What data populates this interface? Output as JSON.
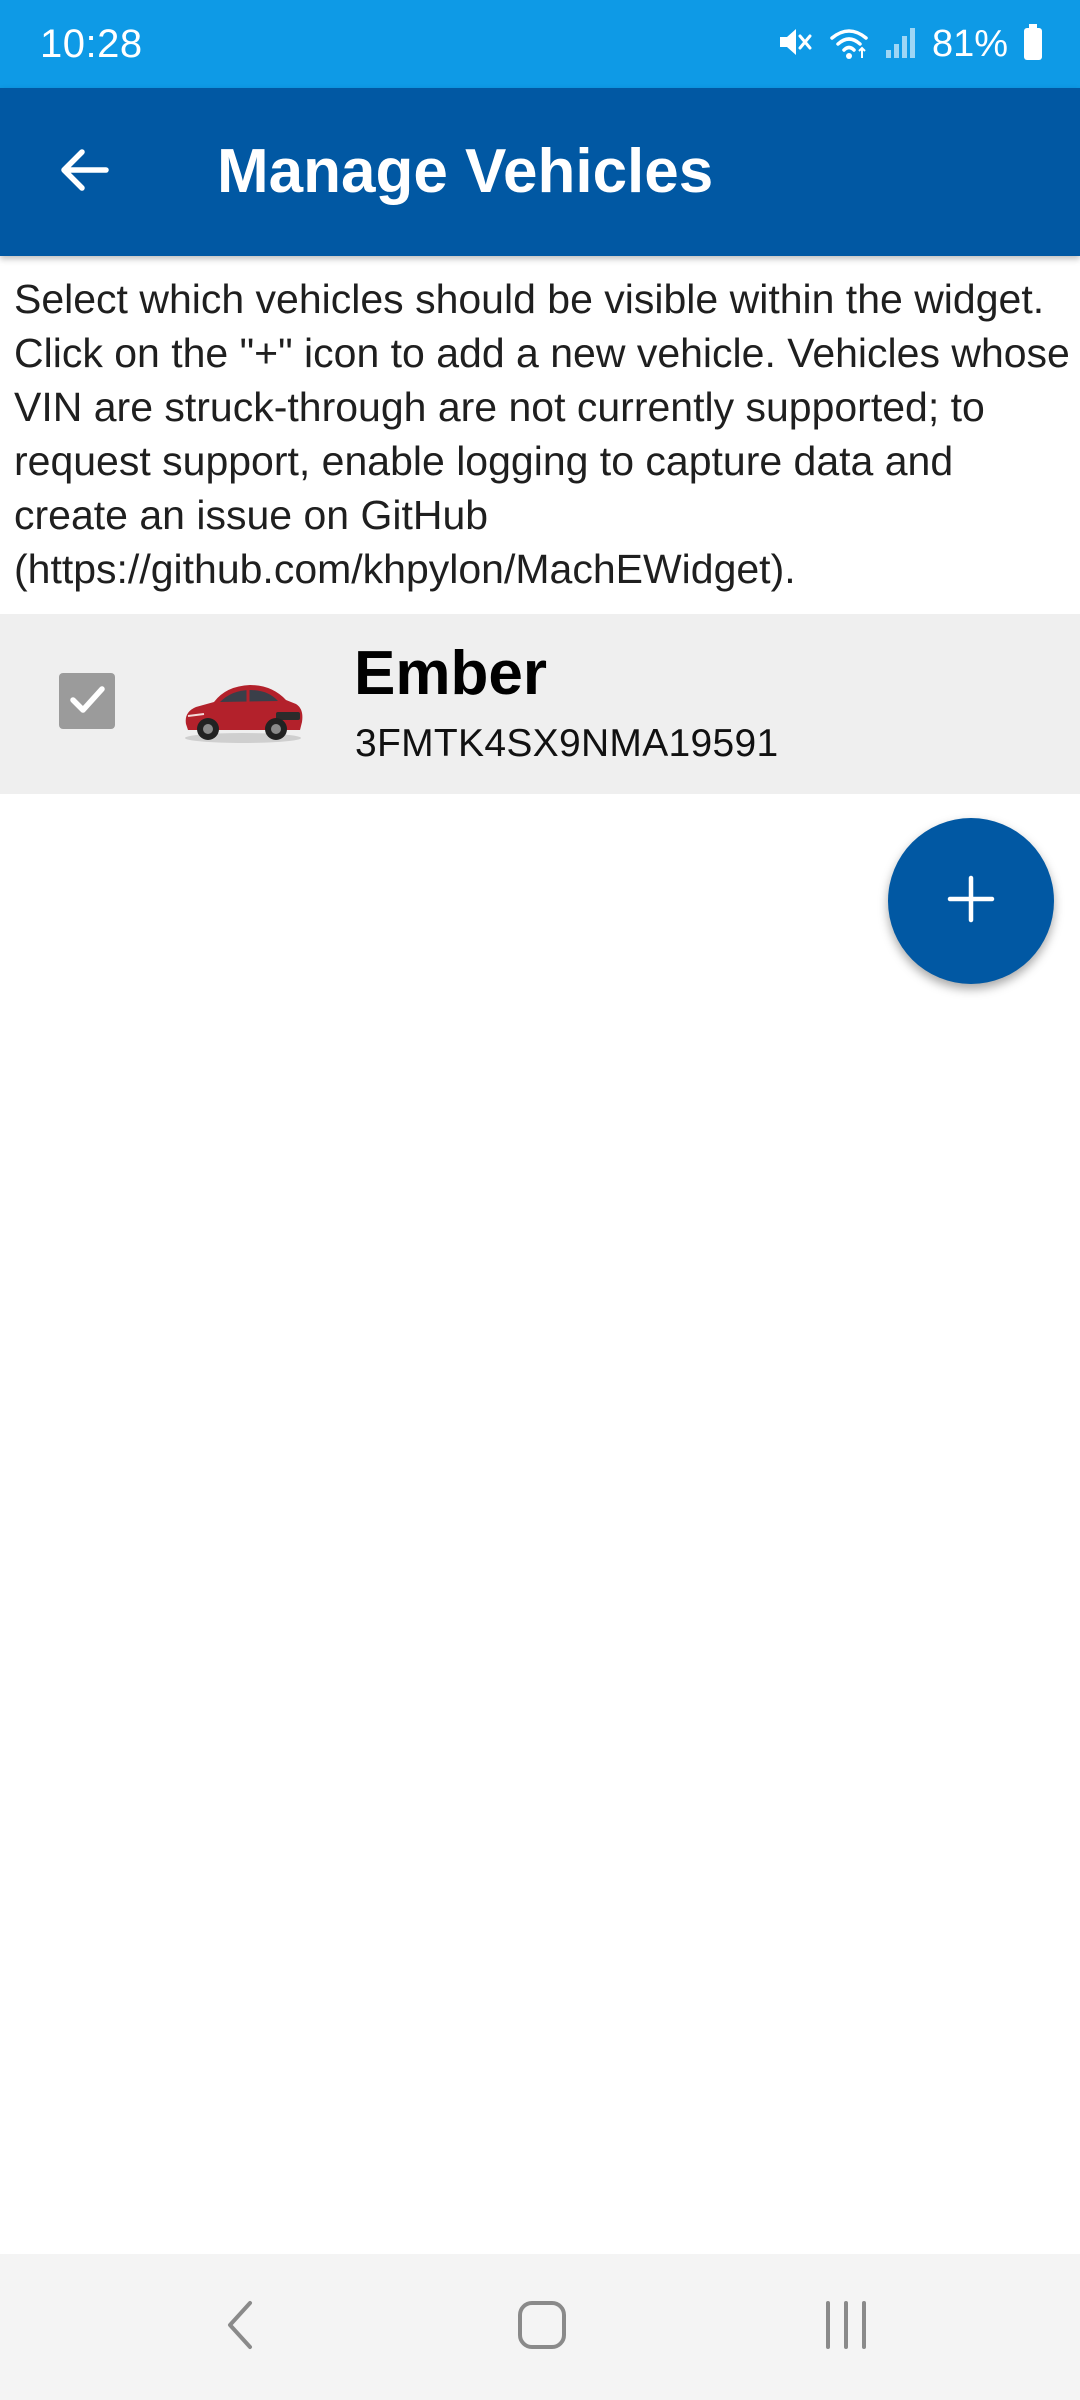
{
  "status_bar": {
    "time": "10:28",
    "battery_text": "81%",
    "icons": [
      "mute-icon",
      "wifi-icon",
      "signal-icon",
      "battery-icon"
    ]
  },
  "app_bar": {
    "title": "Manage Vehicles",
    "back_icon": "arrow-back-icon"
  },
  "description": "Select which vehicles should be visible within the widget. Click on the \"+\" icon to add a new vehicle. Vehicles whose VIN are struck-through are not currently supported; to request support, enable logging to capture data and create an issue on GitHub (https://github.com/khpylon/MachEWidget).",
  "vehicles": [
    {
      "name": "Ember",
      "vin": "3FMTK4SX9NMA19591",
      "checked": true,
      "image": "red-suv-image"
    }
  ],
  "fab": {
    "icon": "plus-icon"
  },
  "nav_bar": {
    "icons": [
      "nav-back-icon",
      "nav-home-icon",
      "nav-recents-icon"
    ]
  },
  "colors": {
    "status_bar": "#0e9ae6",
    "app_bar": "#0158a3",
    "accent": "#0158a3",
    "row_background": "#efefef",
    "checkbox": "#9b9b9b"
  }
}
